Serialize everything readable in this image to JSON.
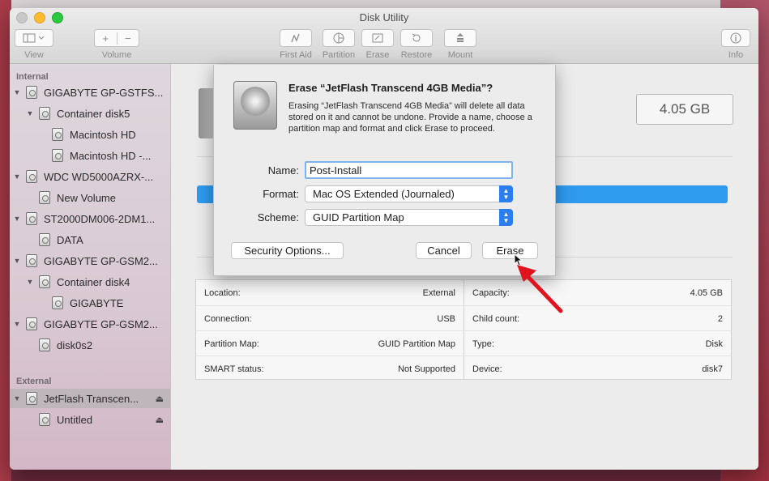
{
  "window": {
    "title": "Disk Utility"
  },
  "toolbar": {
    "view_label": "View",
    "volume_label": "Volume",
    "first_aid_label": "First Aid",
    "partition_label": "Partition",
    "erase_label": "Erase",
    "restore_label": "Restore",
    "mount_label": "Mount",
    "info_label": "Info",
    "add_glyph": "+",
    "remove_glyph": "−"
  },
  "sidebar": {
    "internal_heading": "Internal",
    "external_heading": "External",
    "items": [
      {
        "label": "GIGABYTE GP-GSTFS..."
      },
      {
        "label": "Container disk5"
      },
      {
        "label": "Macintosh HD"
      },
      {
        "label": "Macintosh HD -..."
      },
      {
        "label": "WDC WD5000AZRX-..."
      },
      {
        "label": "New Volume"
      },
      {
        "label": "ST2000DM006-2DM1..."
      },
      {
        "label": "DATA"
      },
      {
        "label": "GIGABYTE GP-GSM2..."
      },
      {
        "label": "Container disk4"
      },
      {
        "label": "GIGABYTE"
      },
      {
        "label": "GIGABYTE GP-GSM2..."
      },
      {
        "label": "disk0s2"
      },
      {
        "label": "JetFlash Transcen..."
      },
      {
        "label": "Untitled"
      }
    ],
    "selected_index": 13
  },
  "main": {
    "capacity_display": "4.05 GB",
    "info": {
      "location_key": "Location:",
      "location_val": "External",
      "connection_key": "Connection:",
      "connection_val": "USB",
      "partition_map_key": "Partition Map:",
      "partition_map_val": "GUID Partition Map",
      "smart_key": "SMART status:",
      "smart_val": "Not Supported",
      "capacity_key": "Capacity:",
      "capacity_val": "4.05 GB",
      "child_count_key": "Child count:",
      "child_count_val": "2",
      "type_key": "Type:",
      "type_val": "Disk",
      "device_key": "Device:",
      "device_val": "disk7"
    }
  },
  "dialog": {
    "title": "Erase “JetFlash Transcend 4GB Media”?",
    "message": "Erasing “JetFlash Transcend 4GB Media” will delete all data stored on it and cannot be undone. Provide a name, choose a partition map and format and click Erase to proceed.",
    "name_label": "Name:",
    "name_value": "Post-Install",
    "format_label": "Format:",
    "format_value": "Mac OS Extended (Journaled)",
    "scheme_label": "Scheme:",
    "scheme_value": "GUID Partition Map",
    "security_button": "Security Options...",
    "cancel_button": "Cancel",
    "erase_button": "Erase"
  },
  "colors": {
    "accent": "#2b7ef0",
    "annotation_arrow": "#e0141e",
    "usage_bar": "#2f9bef"
  },
  "icons": [
    "view-sidebar-icon",
    "first-aid-icon",
    "partition-icon",
    "erase-icon",
    "restore-icon",
    "mount-icon",
    "info-icon",
    "disk-icon",
    "eject-icon",
    "disclosure-triangle-icon",
    "pointer-icon",
    "annotation-arrow-icon"
  ]
}
